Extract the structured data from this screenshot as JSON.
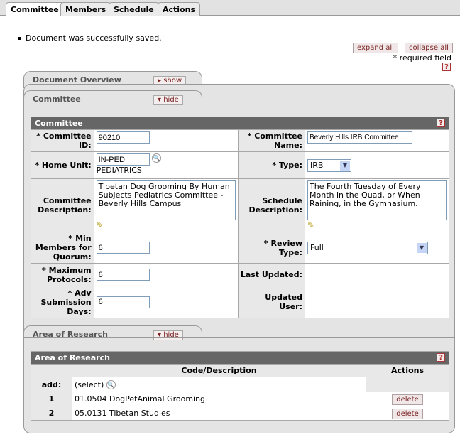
{
  "tabs": [
    "Committee",
    "Members",
    "Schedule",
    "Actions"
  ],
  "message": "Document was successfully saved.",
  "buttons": {
    "expand_all": "expand all",
    "collapse_all": "collapse all",
    "show": "show",
    "hide": "hide",
    "delete": "delete"
  },
  "required_note": "* required field",
  "help": "?",
  "sections": {
    "document_overview": "Document Overview",
    "committee": "Committee",
    "area_of_research": "Area of Research"
  },
  "committee": {
    "header": "Committee",
    "id_label": "* Committee ID:",
    "id_value": "90210",
    "name_label": "* Committee Name:",
    "name_value": "Beverly Hills IRB Committee",
    "unit_label": "* Home Unit:",
    "unit_value": "IN-PED",
    "unit_name": "PEDIATRICS",
    "type_label": "* Type:",
    "type_value": "IRB",
    "desc_label": "Committee Description:",
    "desc_value": "Tibetan Dog Grooming By Human Subjects Pediatrics Committee - Beverly Hills Campus",
    "sched_label": "Schedule Description:",
    "sched_value": "The Fourth Tuesday of Every Month in the Quad, or When Raining, in the Gymnasium.",
    "quorum_label": "* Min Members for Quorum:",
    "quorum_value": "6",
    "review_label": "* Review Type:",
    "review_value": "Full",
    "maxprot_label": "* Maximum Protocols:",
    "maxprot_value": "6",
    "updated_label": "Last Updated:",
    "adv_label": "* Adv Submission Days:",
    "adv_value": "6",
    "user_label": "Updated User:"
  },
  "research": {
    "header": "Area of Research",
    "col_code": "Code/Description",
    "col_actions": "Actions",
    "add_label": "add:",
    "add_value": "(select)",
    "rows": [
      {
        "num": "1",
        "code": "01.0504 DogPetAnimal Grooming"
      },
      {
        "num": "2",
        "code": "05.0131 Tibetan Studies"
      }
    ]
  }
}
